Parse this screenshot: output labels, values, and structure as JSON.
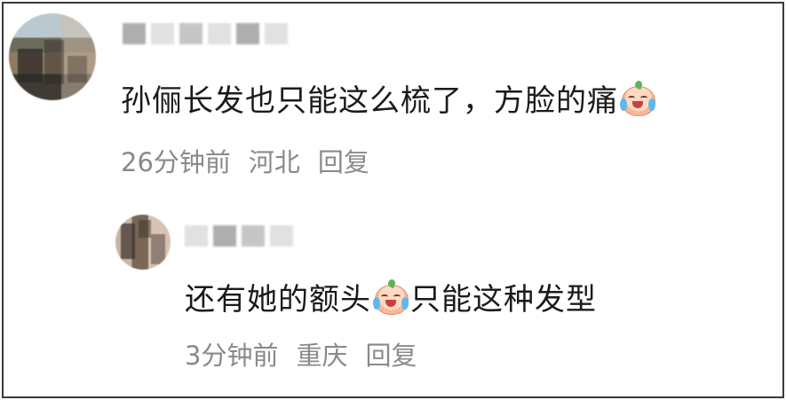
{
  "comments": [
    {
      "username": "",
      "text_before_emoji": "孙俪长发也只能这么梳了，方脸的痛",
      "text_after_emoji": "",
      "emoji": "crying-laughing-peach-icon",
      "time": "26分钟前",
      "location": "河北",
      "reply_label": "回复"
    },
    {
      "username": "",
      "text_before_emoji": "还有她的额头",
      "text_after_emoji": "只能这种发型",
      "emoji": "crying-laughing-peach-icon",
      "time": "3分钟前",
      "location": "重庆",
      "reply_label": "回复"
    }
  ]
}
